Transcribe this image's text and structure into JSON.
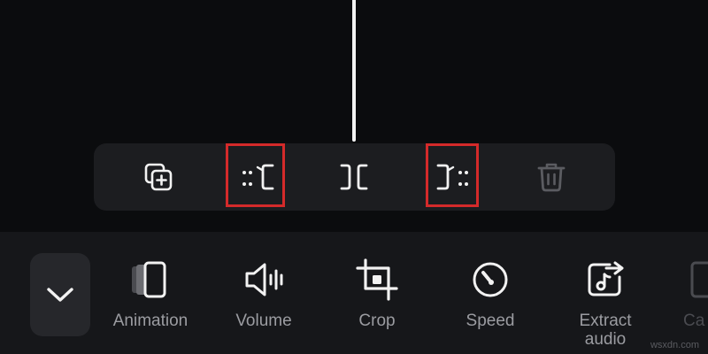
{
  "edit_toolbar": {
    "buttons": [
      {
        "name": "duplicate-icon"
      },
      {
        "name": "split-keep-right-icon"
      },
      {
        "name": "split-icon"
      },
      {
        "name": "split-keep-left-icon"
      },
      {
        "name": "trash-icon"
      }
    ],
    "highlight_color": "#d42a2a"
  },
  "bottom_toolbar": {
    "collapse_icon": "chevron-down-icon",
    "tools": [
      {
        "label": "Animation",
        "icon": "animation-icon"
      },
      {
        "label": "Volume",
        "icon": "volume-icon"
      },
      {
        "label": "Crop",
        "icon": "crop-icon"
      },
      {
        "label": "Speed",
        "icon": "speed-icon"
      },
      {
        "label": "Extract\naudio",
        "icon": "extract-audio-icon"
      },
      {
        "label": "Ca",
        "icon": "partial-tool-icon"
      }
    ]
  },
  "watermark": "wsxdn.com",
  "colors": {
    "background": "#0b0c0e",
    "panel": "#16171a",
    "icon": "#f2f2f2",
    "label": "#9b9ca1",
    "disabled": "#5b5c61"
  }
}
